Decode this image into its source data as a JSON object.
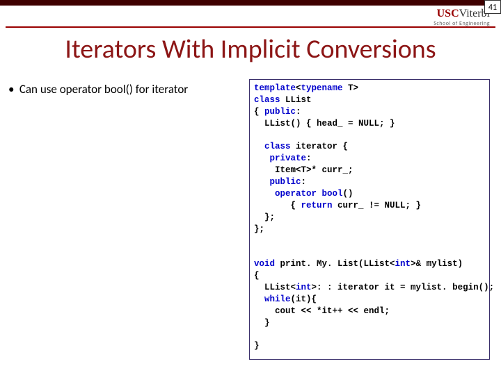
{
  "page_number": "41",
  "logo": {
    "brand1": "USC",
    "brand2": "Viterbi",
    "sub": "School of Engineering"
  },
  "title": "Iterators With Implicit Conversions",
  "bullet": "Can use operator bool() for iterator",
  "code": {
    "l1a": "template",
    "l1b": "<",
    "l1c": "typename",
    "l1d": " T>",
    "l2a": "class",
    "l2b": " LList",
    "l3a": "{ ",
    "l3b": "public",
    "l3c": ":",
    "l4a": "  LList() { head_ = NULL; }",
    "l6a": "  class",
    "l6b": " iterator {",
    "l7a": "   private",
    "l7b": ":",
    "l8a": "    Item<T>* curr_;",
    "l9a": "   public",
    "l9b": ":",
    "l10a": "    operator",
    "l10b": " ",
    "l10c": "bool",
    "l10d": "()",
    "l11a": "       { ",
    "l11b": "return",
    "l11c": " curr_ != NULL; }",
    "l12a": "  };",
    "l13a": "};",
    "l15a": "void",
    "l15b": " print. My. List(LList<",
    "l15c": "int",
    "l15d": ">& mylist)",
    "l16a": "{",
    "l17a": "  LList<",
    "l17b": "int",
    "l17c": ">: : iterator it = mylist. begin();",
    "l18a": "  while",
    "l18b": "(it){",
    "l19a": "    cout << *it++ << endl;",
    "l20a": "  }",
    "l22a": "}"
  }
}
